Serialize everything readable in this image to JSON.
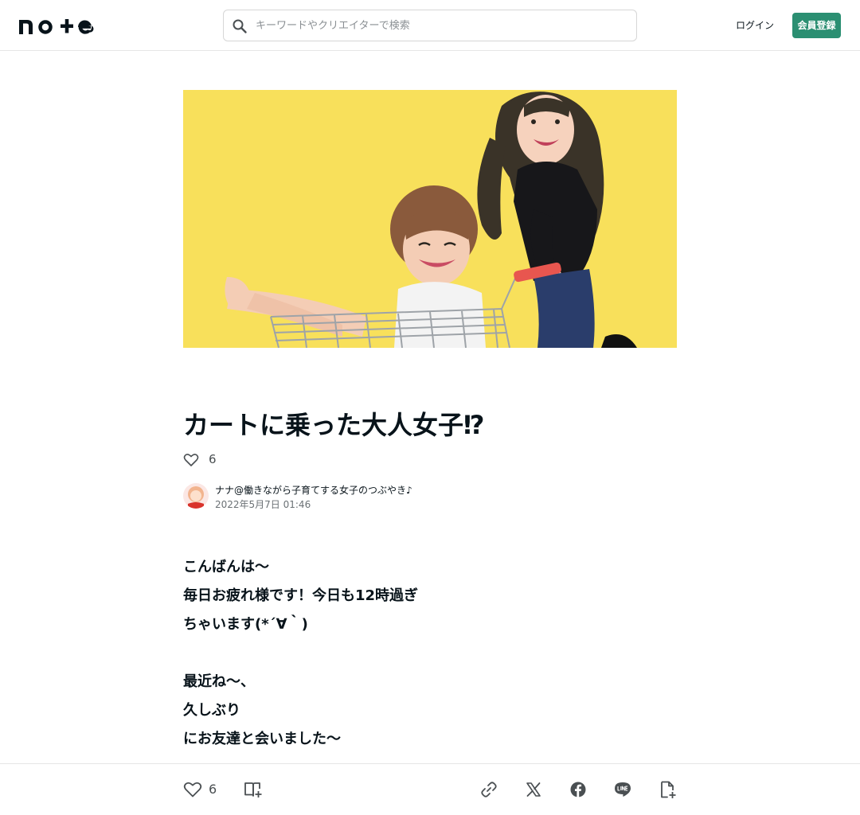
{
  "header": {
    "logo": "note",
    "search_placeholder": "キーワードやクリエイターで検索",
    "login_label": "ログイン",
    "signup_label": "会員登録"
  },
  "article": {
    "title": "カートに乗った大人女子⁉︎",
    "like_count": "6",
    "author": {
      "name": "ナナ@働きながら子育てする女子のつぶやき♪",
      "date": "2022年5月7日 01:46"
    },
    "body": [
      "こんばんは〜",
      "毎日お疲れ様です！今日も12時過ぎ",
      "ちゃいます(*´∀｀)",
      "",
      "最近ね〜、",
      "久しぶり",
      "にお友達と会いました〜"
    ]
  },
  "bottom_bar": {
    "like_count": "6"
  },
  "colors": {
    "accent": "#2b8f72",
    "hero_background": "#f8e05b",
    "text": "#08131a"
  },
  "icons": [
    "search-icon",
    "heart-icon",
    "magazine-add-icon",
    "link-icon",
    "x-icon",
    "facebook-icon",
    "line-icon",
    "note-embed-icon"
  ]
}
